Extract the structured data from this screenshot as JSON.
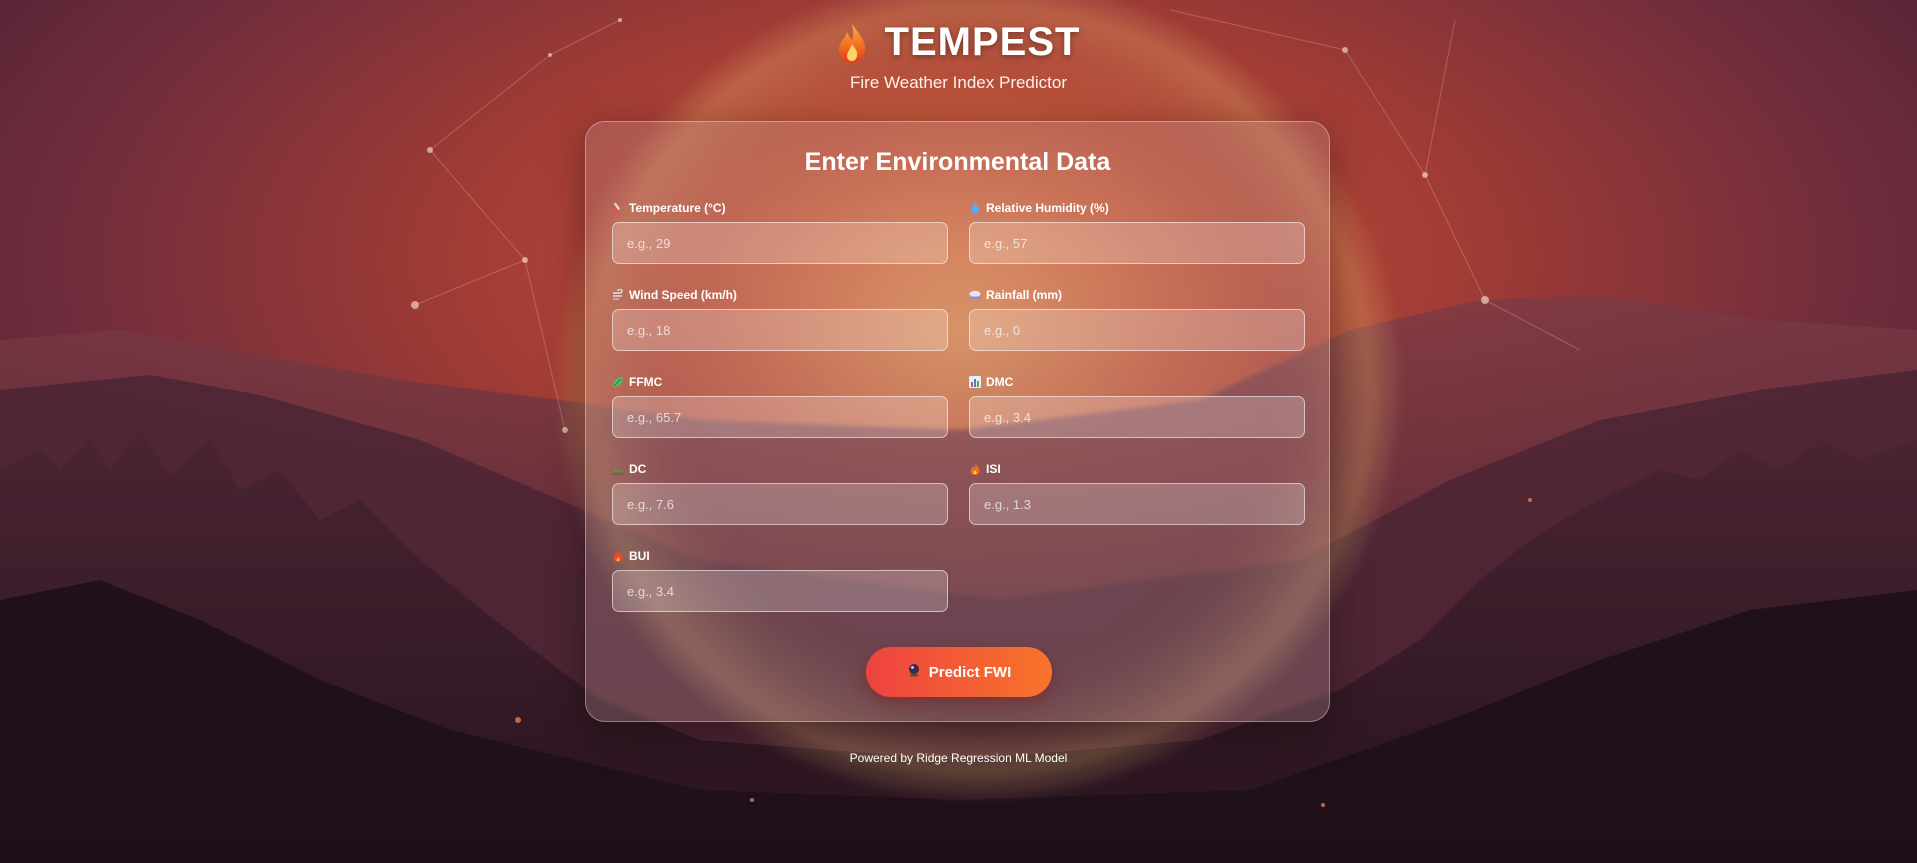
{
  "header": {
    "title": "TEMPEST",
    "subtitle": "Fire Weather Index Predictor",
    "logo_icon": "flame-icon"
  },
  "form": {
    "title": "Enter Environmental Data",
    "fields": [
      {
        "label": "Temperature (°C)",
        "placeholder": "e.g., 29",
        "icon": "thermometer-icon"
      },
      {
        "label": "Relative Humidity (%)",
        "placeholder": "e.g., 57",
        "icon": "droplet-icon"
      },
      {
        "label": "Wind Speed (km/h)",
        "placeholder": "e.g., 18",
        "icon": "wind-icon"
      },
      {
        "label": "Rainfall (mm)",
        "placeholder": "e.g., 0",
        "icon": "rain-cloud-icon"
      },
      {
        "label": "FFMC",
        "placeholder": "e.g., 65.7",
        "icon": "leaf-icon"
      },
      {
        "label": "DMC",
        "placeholder": "e.g., 3.4",
        "icon": "bar-chart-icon"
      },
      {
        "label": "DC",
        "placeholder": "e.g., 7.6",
        "icon": "landscape-icon"
      },
      {
        "label": "ISI",
        "placeholder": "e.g., 1.3",
        "icon": "fire-icon"
      },
      {
        "label": "BUI",
        "placeholder": "e.g., 3.4",
        "icon": "flame-small-icon"
      }
    ],
    "submit_label": "Predict FWI",
    "submit_icon": "crystal-ball-icon"
  },
  "footer": {
    "text": "Powered by Ridge Regression ML Model"
  },
  "colors": {
    "button_start": "#ee4340",
    "button_end": "#f7742a",
    "background_warm": "#c8553a",
    "background_dark": "#3a1c2c"
  }
}
